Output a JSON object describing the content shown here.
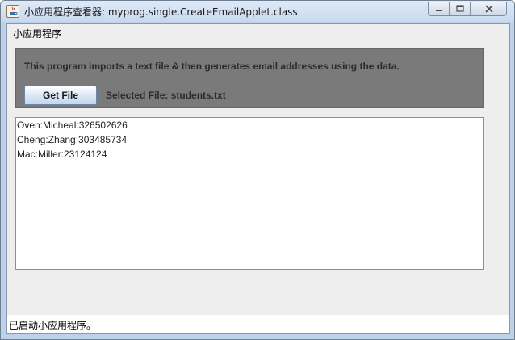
{
  "window": {
    "title": "小应用程序查看器: myprog.single.CreateEmailApplet.class",
    "icon": "java-icon",
    "controls": [
      "minimize-icon",
      "maximize-icon",
      "close-icon"
    ]
  },
  "applet": {
    "menu_label": "小应用程序",
    "info_text": "This program imports a text file & then generates email addresses using the data.",
    "get_file_label": "Get File",
    "selected_file_text": "Selected File: students.txt",
    "lines": [
      "Oven:Micheal:326502626",
      "Cheng:Zhang:303485734",
      "Mac:Miller:23124124"
    ]
  },
  "status": {
    "text": "已启动小应用程序。"
  },
  "colors": {
    "panel": "#7a7a7a",
    "window_frame": "#bcd1ea",
    "client_bg": "#eeeeee"
  }
}
